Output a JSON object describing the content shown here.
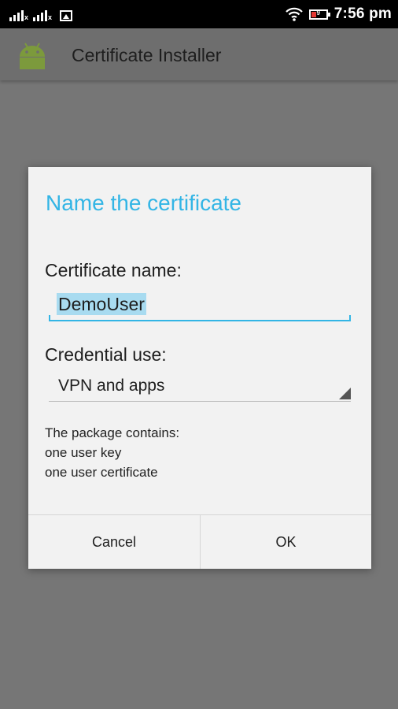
{
  "status_bar": {
    "time": "7:56 pm",
    "battery_level": "9",
    "icons": [
      "signal-1-icon",
      "signal-2-icon",
      "image-notification-icon",
      "wifi-icon",
      "battery-icon"
    ]
  },
  "action_bar": {
    "title": "Certificate Installer",
    "icon": "android-icon"
  },
  "dialog": {
    "title": "Name the certificate",
    "name_label": "Certificate name:",
    "name_value": "DemoUser",
    "credential_label": "Credential use:",
    "credential_value": "VPN and apps",
    "package_lines": [
      "The package contains:",
      "one user key",
      "one user certificate"
    ],
    "cancel_label": "Cancel",
    "ok_label": "OK"
  },
  "colors": {
    "accent": "#33b5e5",
    "dim_background": "#767676",
    "dialog_background": "#f2f2f2",
    "android_green": "#7c9a3c"
  }
}
